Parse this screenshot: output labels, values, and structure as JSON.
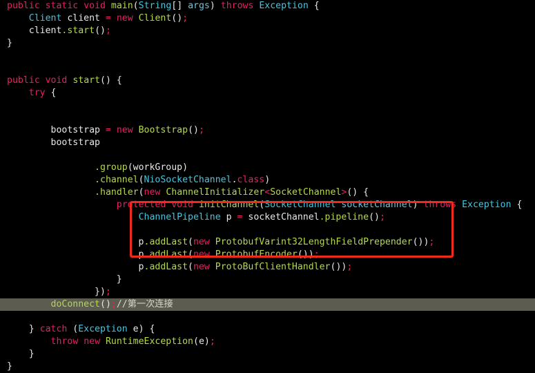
{
  "editor": {
    "background_color": "#000000",
    "default_text_color": "#e8e8e8",
    "highlight_line_color": "#5c5c50",
    "annotation_box_color": "#f02a1d",
    "syntax_colors": {
      "keyword": "#ef1d62",
      "type": "#44c6e0",
      "method": "#b5d94b",
      "identifier": "#e8e8e8",
      "parameter": "#6ec3dd",
      "comment": "#d6d6cc",
      "punctuation": "#e8e8e8"
    },
    "language": "Java"
  },
  "lines": [
    {
      "n": 1,
      "text": "public static void main(String[] args) throws Exception {"
    },
    {
      "n": 2,
      "text": "    Client client = new Client();"
    },
    {
      "n": 3,
      "text": "    client.start();"
    },
    {
      "n": 4,
      "text": "}"
    },
    {
      "n": 5,
      "text": ""
    },
    {
      "n": 6,
      "text": ""
    },
    {
      "n": 7,
      "text": "public void start() {"
    },
    {
      "n": 8,
      "text": "    try {"
    },
    {
      "n": 9,
      "text": ""
    },
    {
      "n": 10,
      "text": ""
    },
    {
      "n": 11,
      "text": "        bootstrap = new Bootstrap();"
    },
    {
      "n": 12,
      "text": "        bootstrap"
    },
    {
      "n": 13,
      "text": ""
    },
    {
      "n": 14,
      "text": "                .group(workGroup)"
    },
    {
      "n": 15,
      "text": "                .channel(NioSocketChannel.class)"
    },
    {
      "n": 16,
      "text": "                .handler(new ChannelInitializer<SocketChannel>() {"
    },
    {
      "n": 17,
      "text": "                    protected void initChannel(SocketChannel socketChannel) throws Exception {"
    },
    {
      "n": 18,
      "text": "                        ChannelPipeline p = socketChannel.pipeline();"
    },
    {
      "n": 19,
      "text": ""
    },
    {
      "n": 20,
      "text": "                        p.addLast(new ProtobufVarint32LengthFieldPrepender());"
    },
    {
      "n": 21,
      "text": "                        p.addLast(new ProtobufEncoder());"
    },
    {
      "n": 22,
      "text": "                        p.addLast(new ProtoBufClientHandler());"
    },
    {
      "n": 23,
      "text": "                    }"
    },
    {
      "n": 24,
      "text": "                });"
    },
    {
      "n": 25,
      "text": "        doConnect();//第一次连接"
    },
    {
      "n": 26,
      "text": ""
    },
    {
      "n": 27,
      "text": "    } catch (Exception e) {"
    },
    {
      "n": 28,
      "text": "        throw new RuntimeException(e);"
    },
    {
      "n": 29,
      "text": "    }"
    },
    {
      "n": 30,
      "text": "}"
    }
  ],
  "highlighted_line": {
    "number": 25,
    "code": "doConnect();",
    "comment": "//第一次连接"
  },
  "annotation": {
    "type": "red-rectangle",
    "color": "#f02a1d",
    "encloses_lines": [
      20,
      21,
      22
    ],
    "enclosed_code": [
      "p.addLast(new ProtobufVarint32LengthFieldPrepender());",
      "p.addLast(new ProtobufEncoder());",
      "p.addLast(new ProtoBufClientHandler());"
    ]
  },
  "tokens": {
    "l1": {
      "t1": "public",
      "t2": " ",
      "t3": "static",
      "t4": " ",
      "t5": "void",
      "t6": " ",
      "t7": "main",
      "t8": "(",
      "t9": "String",
      "t10": "[] ",
      "t11": "args",
      "t12": ") ",
      "t13": "throws",
      "t14": " ",
      "t15": "Exception",
      "t16": " {"
    },
    "l2": {
      "t1": "    ",
      "t2": "Client",
      "t3": " client ",
      "t4": "=",
      "t5": " ",
      "t6": "new",
      "t7": " ",
      "t8": "Client",
      "t9": "()",
      "t10": ";"
    },
    "l3": {
      "t1": "    client",
      "t2": ".",
      "t3": "start",
      "t4": "()",
      "t5": ";"
    },
    "l4": {
      "t1": "}"
    },
    "l7": {
      "t1": "public",
      "t2": " ",
      "t3": "void",
      "t4": " ",
      "t5": "start",
      "t6": "() {"
    },
    "l8": {
      "t1": "    ",
      "t2": "try",
      "t3": " {"
    },
    "l11": {
      "t1": "        bootstrap ",
      "t2": "=",
      "t3": " ",
      "t4": "new",
      "t5": " ",
      "t6": "Bootstrap",
      "t7": "()",
      "t8": ";"
    },
    "l12": {
      "t1": "        bootstrap"
    },
    "l14": {
      "t1": "                ",
      "t2": ".",
      "t3": "group",
      "t4": "(workGroup)"
    },
    "l15": {
      "t1": "                ",
      "t2": ".",
      "t3": "channel",
      "t4": "(",
      "t5": "NioSocketChannel",
      "t6": ".",
      "t7": "class",
      "t8": ")"
    },
    "l16": {
      "t1": "                ",
      "t2": ".",
      "t3": "handler",
      "t4": "(",
      "t5": "new",
      "t6": " ",
      "t7": "ChannelInitializer",
      "t8": "<",
      "t9": "SocketChannel",
      "t10": ">",
      "t11": "() {"
    },
    "l17": {
      "t1": "                    ",
      "t2": "protected",
      "t3": " ",
      "t4": "void",
      "t5": " ",
      "t6": "initChannel",
      "t7": "(",
      "t8": "SocketChannel",
      "t9": " ",
      "t10": "socketChannel",
      "t11": ") ",
      "t12": "throws",
      "t13": " ",
      "t14": "Exception",
      "t15": " {"
    },
    "l18": {
      "t1": "                        ",
      "t2": "ChannelPipeline",
      "t3": " p ",
      "t4": "=",
      "t5": " socketChannel",
      "t6": ".",
      "t7": "pipeline",
      "t8": "()",
      "t9": ";"
    },
    "l20": {
      "t1": "                        p",
      "t2": ".",
      "t3": "addLast",
      "t4": "(",
      "t5": "new",
      "t6": " ",
      "t7": "ProtobufVarint32LengthFieldPrepender",
      "t8": "())",
      "t9": ";"
    },
    "l21": {
      "t1": "                        p",
      "t2": ".",
      "t3": "addLast",
      "t4": "(",
      "t5": "new",
      "t6": " ",
      "t7": "ProtobufEncoder",
      "t8": "())",
      "t9": ";"
    },
    "l22": {
      "t1": "                        p",
      "t2": ".",
      "t3": "addLast",
      "t4": "(",
      "t5": "new",
      "t6": " ",
      "t7": "ProtoBufClientHandler",
      "t8": "())",
      "t9": ";"
    },
    "l23": {
      "t1": "                    }"
    },
    "l24": {
      "t1": "                })",
      "t2": ";"
    },
    "l25": {
      "t1": "        ",
      "t2": "doConnect",
      "t3": "()",
      "t4": ";",
      "t5": "//第一次连接"
    },
    "l27": {
      "t1": "    } ",
      "t2": "catch",
      "t3": " (",
      "t4": "Exception",
      "t5": " e) {"
    },
    "l28": {
      "t1": "        ",
      "t2": "throw",
      "t3": " ",
      "t4": "new",
      "t5": " ",
      "t6": "RuntimeException",
      "t7": "(e)",
      "t8": ";"
    },
    "l29": {
      "t1": "    }"
    },
    "l30": {
      "t1": "}"
    }
  }
}
